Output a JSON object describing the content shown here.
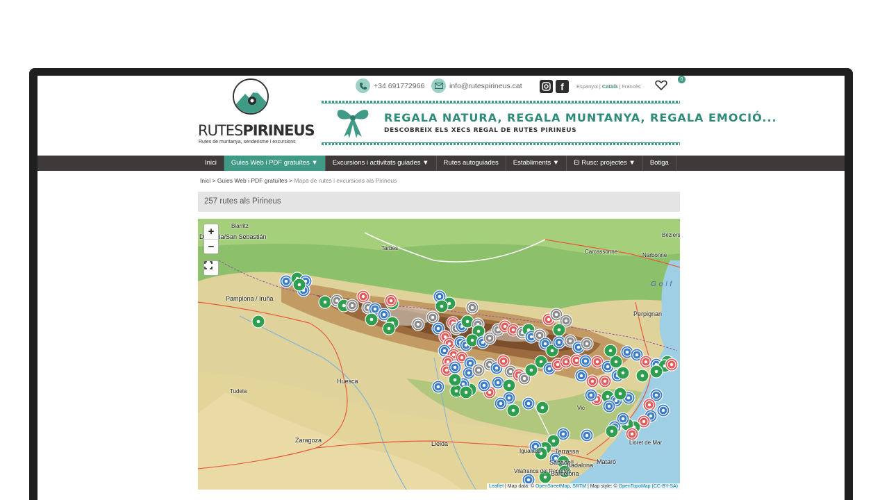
{
  "site": {
    "logo_title_light": "RUTES",
    "logo_title_bold": "PIRINEUS",
    "logo_tagline": "Rutes de muntanya, senderisme i excursions"
  },
  "contact": {
    "phone": "+34 691772966",
    "email": "info@rutespirineus.cat"
  },
  "languages": {
    "es": "Espanyol",
    "ca": "Català",
    "fr": "Francès"
  },
  "wishlist_count": "0",
  "promo": {
    "headline": "REGALA NATURA, REGALA MUNTANYA, REGALA EMOCIÓ...",
    "subline": "DESCOBREIX ELS XECS REGAL DE RUTES PIRINEUS"
  },
  "nav": {
    "items": [
      {
        "label": "Inici"
      },
      {
        "label": "Guies Web i PDF gratuïtes ▼"
      },
      {
        "label": "Excursions i activitats guiades ▼"
      },
      {
        "label": "Rutes autoguiades"
      },
      {
        "label": "Establiments ▼"
      },
      {
        "label": "El Rusc: projectes ▼"
      },
      {
        "label": "Botiga"
      }
    ]
  },
  "breadcrumb": {
    "home": "Inici",
    "section": "Guies Web i PDF gratuïtes",
    "sep": " > ",
    "current": "Mapa de rutes i excursions als Pirineus"
  },
  "result_title": "257 rutes als Pirineus",
  "map": {
    "zoom_in": "+",
    "zoom_out": "−",
    "places": {
      "biarritz": "Biarritz",
      "donostia": "Donostia/San Sebastián",
      "tarbes": "Tarbes",
      "carcassonne": "Carcassonne",
      "narbonne": "Narbonne",
      "beziers": "Béziers",
      "pamplona": "Pamplona / Iruña",
      "perpignan": "Perpignan",
      "huesca": "Huesca",
      "tudela": "Tudela",
      "zaragoza": "Zaragoza",
      "lleida": "Lleida",
      "terrassa": "Terrassa",
      "mataro": "Mataró",
      "sabadell": "Sabadell",
      "badalona": "Badalona",
      "vic": "Vic",
      "lloret": "Lloret de Mar",
      "igualada": "Igualada",
      "vilafranca": "Vilafranca del Penedès",
      "barcelona": "Barcelona"
    },
    "sea_label": "Golf",
    "attribution": {
      "leaflet": "Leaflet",
      "text1": " | Map data: © ",
      "osm": "OpenStreetMap",
      "text2": ", ",
      "srtm": "SRTM",
      "text3": " | Map style: © ",
      "otm": "OpenTopoMap",
      "text4": " ",
      "license": "(CC-BY-SA)"
    },
    "marker_colors": {
      "blue": "#3a7bc8",
      "red": "#e05a5a",
      "green": "#2e9e4f",
      "gray": "#8a8a8a"
    }
  }
}
